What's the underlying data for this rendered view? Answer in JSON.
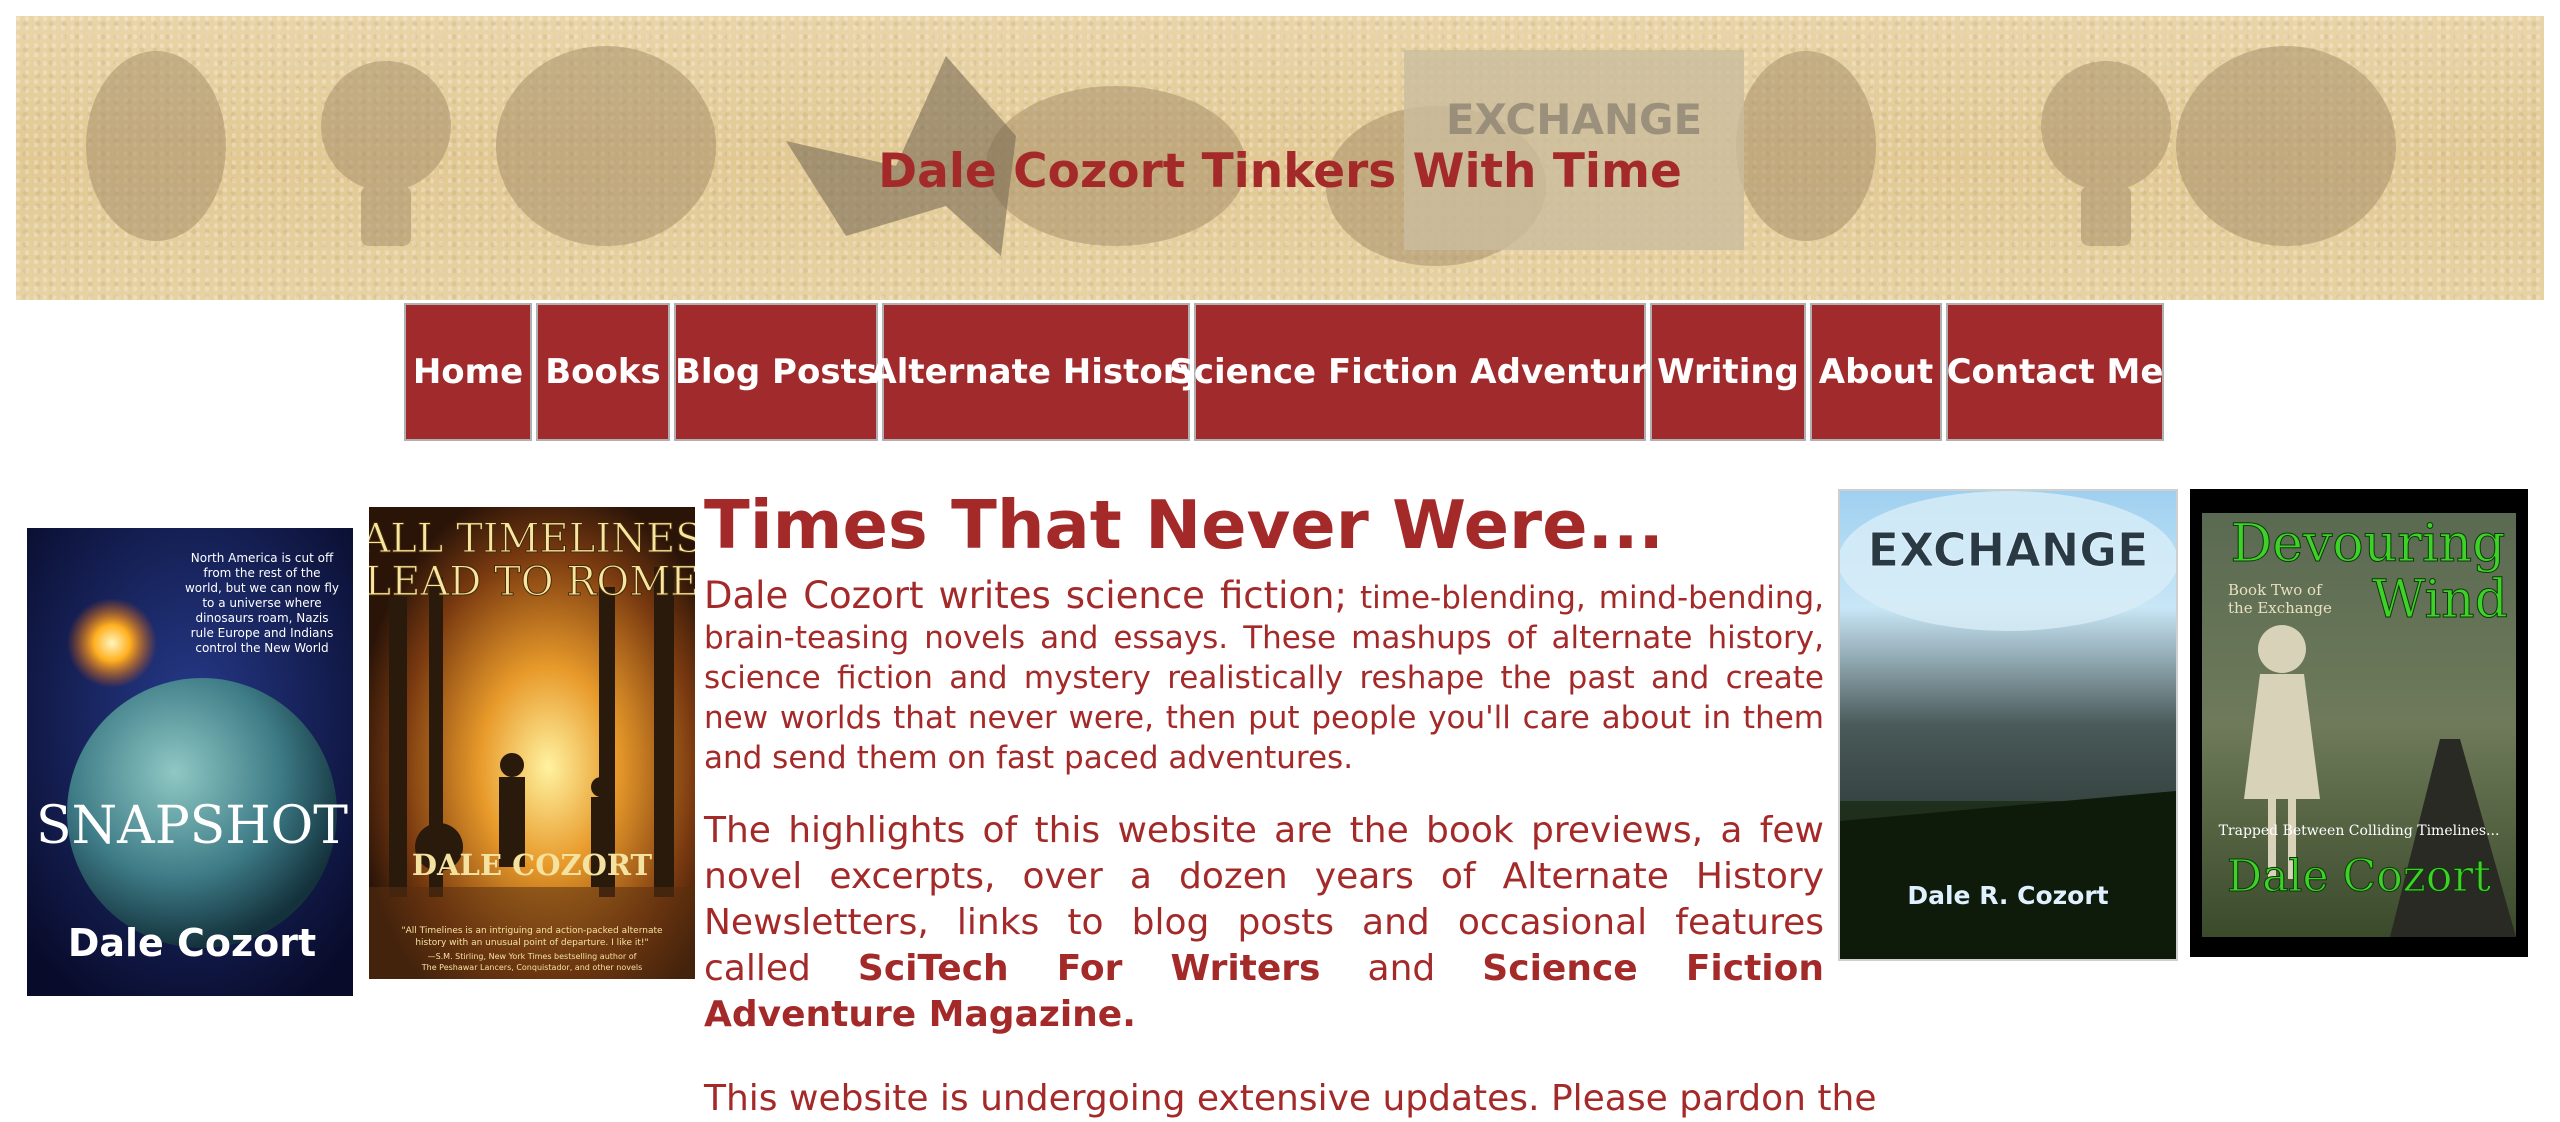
{
  "site": {
    "title": "Dale Cozort Tinkers With Time"
  },
  "nav": {
    "items": [
      {
        "label": "Home"
      },
      {
        "label": "Books"
      },
      {
        "label": "Blog Posts"
      },
      {
        "label": "Alternate History"
      },
      {
        "label": "Science Fiction Adventure"
      },
      {
        "label": "Writing"
      },
      {
        "label": "About"
      },
      {
        "label": "Contact Me"
      }
    ]
  },
  "covers": {
    "snapshot": {
      "blurb": [
        "North America is cut off",
        "from the rest of the",
        "world, but we can now fly",
        "to a universe where",
        "dinosaurs roam, Nazis",
        "rule Europe and Indians",
        "control the New World"
      ],
      "title": "SNAPSHOT",
      "author": "Dale Cozort"
    },
    "timelines": {
      "title_line1": "ALL TIMELINES",
      "title_line2": "LEAD TO ROME",
      "author": "DALE COZORT",
      "quote_line1": "\"All Timelines is an intriguing and action-packed alternate",
      "quote_line2": "history with an unusual point of departure. I like it!\"",
      "attrib_line1": "—S.M. Stirling, New York Times bestselling author of",
      "attrib_line2": "The Peshawar Lancers, Conquistador, and other novels"
    },
    "exchange": {
      "title": "EXCHANGE",
      "author": "Dale R. Cozort"
    },
    "devouring": {
      "title_line1": "Devouring",
      "title_line2": "Wind",
      "subtitle_line1": "Book Two of",
      "subtitle_line2": "the Exchange",
      "tagline": "Trapped Between Colliding Timelines...",
      "author": "Dale Cozort"
    }
  },
  "banner": {
    "logo_text": "EXCHANGE"
  },
  "main": {
    "heading": "Times That Never Were...",
    "intro_lead": "Dale Cozort writes science fiction;",
    "intro_rest": " time-blending, mind-bending, brain-teasing novels and essays. These mashups of alternate history, science fiction and mystery realistically reshape the past and create new worlds that never were, then put people you'll care about in them and send them on fast paced adventures.",
    "highlights_pre": "The highlights of this website are the book previews, a few novel excerpts, over a dozen years of Alternate History Newsletters, links to blog posts and occasional features called ",
    "highlights_bold1": "SciTech For Writers",
    "highlights_mid": " and ",
    "highlights_bold2": "Science Fiction Adventure Magazine.",
    "cutoff_text": "This website is undergoing extensive updates. Please pardon the"
  },
  "colors": {
    "accent": "#a42a2a",
    "nav_bg": "#a12a2c",
    "banner_bg": "#e5cf9e"
  }
}
